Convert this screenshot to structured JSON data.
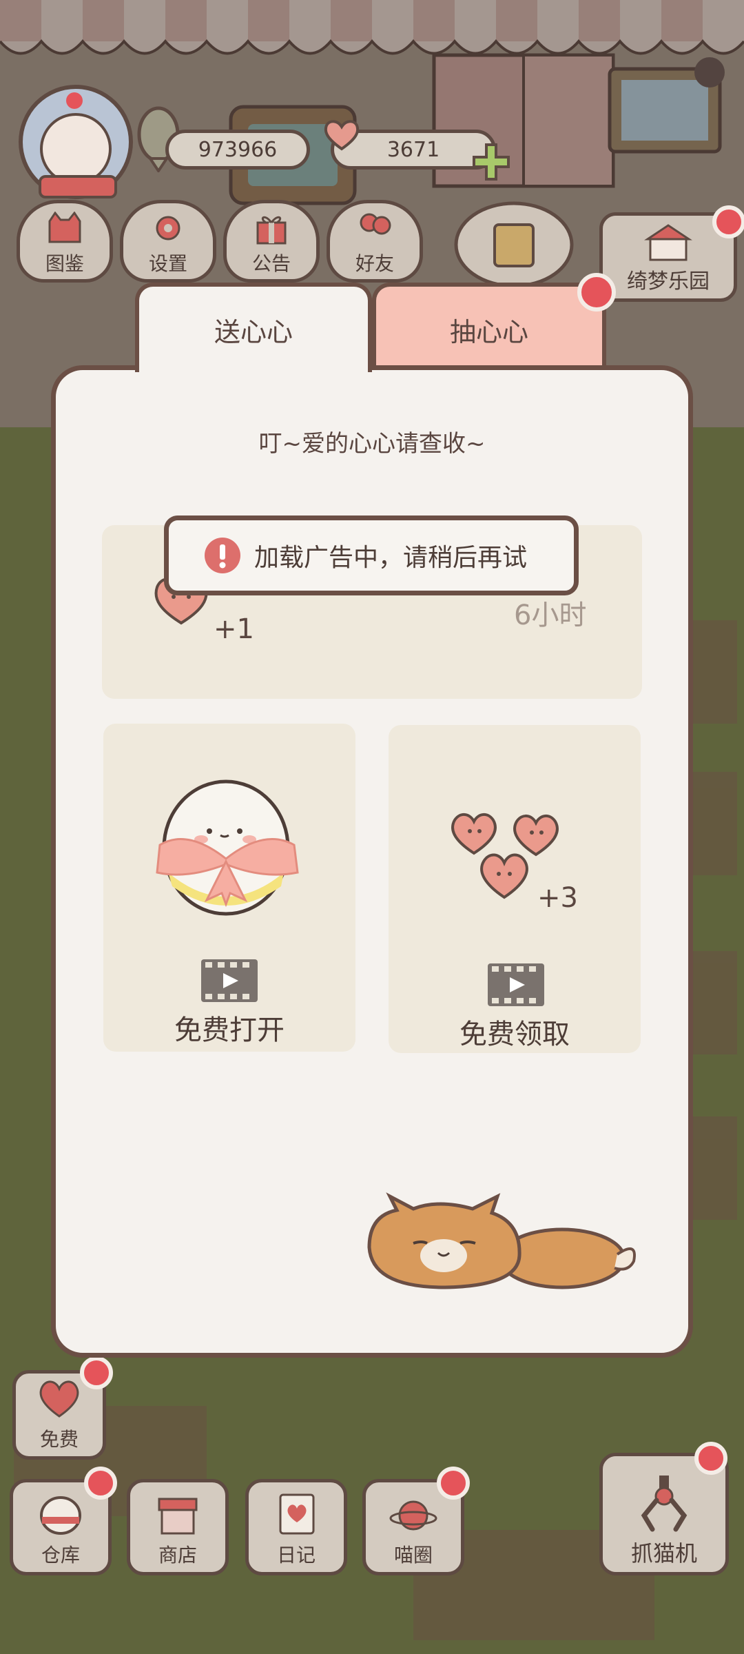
{
  "top_bar": {
    "fish_count": "973966",
    "heart_count": "3671"
  },
  "top_menu": {
    "items": [
      {
        "label": "图鉴",
        "icon": "cat-book-icon"
      },
      {
        "label": "设置",
        "icon": "gear-icon"
      },
      {
        "label": "公告",
        "icon": "gift-icon"
      },
      {
        "label": "好友",
        "icon": "friends-icon"
      }
    ],
    "park": {
      "label": "绮梦乐园",
      "icon": "carousel-icon"
    }
  },
  "dialog": {
    "tabs": [
      {
        "label": "送心心",
        "active": true
      },
      {
        "label": "抽心心",
        "active": false
      }
    ],
    "subtitle": "叮~爱的心心请查收~",
    "timer_card": {
      "reward": "+1",
      "time_text": "6小时"
    },
    "toast": {
      "icon": "exclamation-icon",
      "text": "加载广告中，请稍后再试"
    },
    "egg_card": {
      "label": "免费打开",
      "icon": "video-icon"
    },
    "hearts_card": {
      "reward": "+3",
      "label": "免费领取",
      "icon": "video-icon"
    }
  },
  "side_labels": {
    "free": "免费"
  },
  "bottom_nav": {
    "items": [
      {
        "label": "仓库",
        "icon": "storage-icon"
      },
      {
        "label": "商店",
        "icon": "shop-icon"
      },
      {
        "label": "日记",
        "icon": "diary-icon"
      },
      {
        "label": "喵圈",
        "icon": "cat-planet-icon"
      }
    ],
    "claw": {
      "label": "抓猫机",
      "icon": "claw-icon"
    }
  },
  "colors": {
    "accent_pink": "#f7c2b6",
    "panel": "#f5f2ee",
    "border": "#6b4f45",
    "badge_red": "#e5545a"
  }
}
